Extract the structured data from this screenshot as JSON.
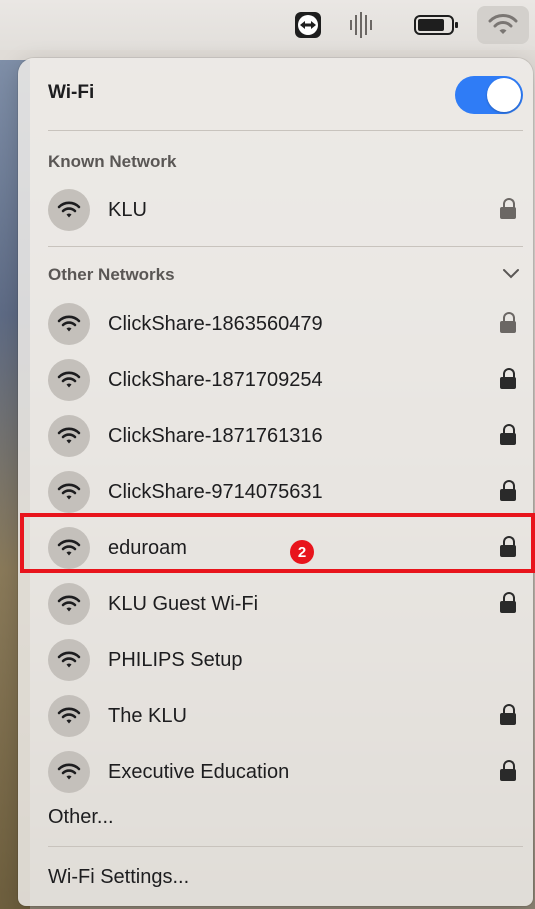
{
  "menubar": {
    "icons": [
      "teamviewer-icon",
      "audio-bars-icon",
      "battery-icon",
      "wifi-icon"
    ]
  },
  "wifi_panel": {
    "title": "Wi-Fi",
    "enabled": true,
    "known_label": "Known Network",
    "known_networks": [
      {
        "name": "KLU",
        "locked": true
      }
    ],
    "other_label": "Other Networks",
    "other_networks": [
      {
        "name": "ClickShare-1863560479",
        "locked": true
      },
      {
        "name": "ClickShare-1871709254",
        "locked": true
      },
      {
        "name": "ClickShare-1871761316",
        "locked": true
      },
      {
        "name": "ClickShare-9714075631",
        "locked": true
      },
      {
        "name": "eduroam",
        "locked": true
      },
      {
        "name": "KLU Guest Wi-Fi",
        "locked": true
      },
      {
        "name": "PHILIPS Setup",
        "locked": false
      },
      {
        "name": "The KLU",
        "locked": true
      },
      {
        "name": "Executive Education",
        "locked": true
      }
    ],
    "other_item": "Other...",
    "settings_item": "Wi-Fi Settings..."
  },
  "annotation": {
    "badge_number": "2",
    "highlight_color": "#e8141c"
  },
  "colors": {
    "toggle_on": "#2f7cf6"
  }
}
